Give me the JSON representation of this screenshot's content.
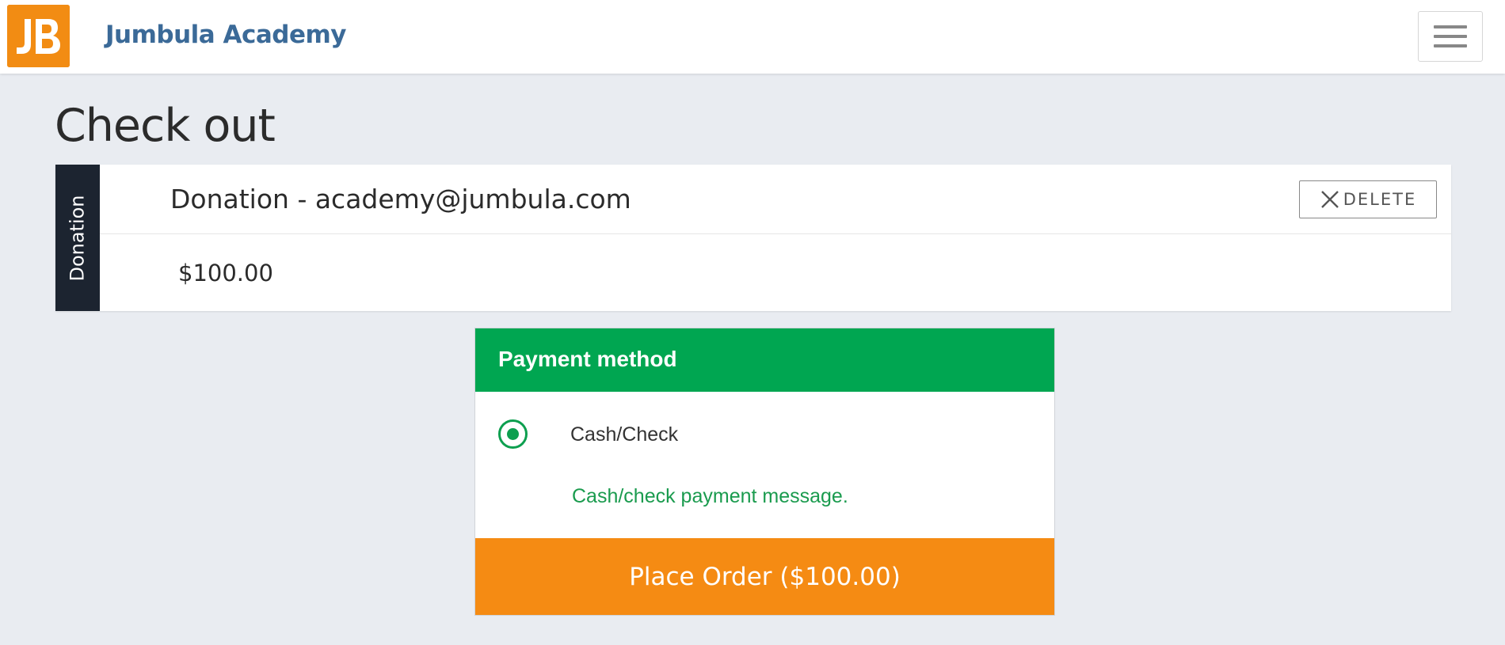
{
  "brand": {
    "name": "Jumbula Academy",
    "logo_icon": "jumbula-logo",
    "logo_color": "#f28c13"
  },
  "nav": {
    "menu_icon": "hamburger-menu-icon"
  },
  "page": {
    "title": "Check out"
  },
  "cart_item": {
    "tag": "Donation",
    "title": "Donation - academy@jumbula.com",
    "delete_label": "DELETE",
    "delete_icon": "close-icon",
    "price": "$100.00"
  },
  "payment": {
    "header": "Payment method",
    "options": [
      {
        "label": "Cash/Check",
        "selected": true
      }
    ],
    "message": "Cash/check payment message.",
    "place_order_label": "Place Order ($100.00)",
    "colors": {
      "header": "#00a651",
      "button": "#f58b13"
    }
  }
}
